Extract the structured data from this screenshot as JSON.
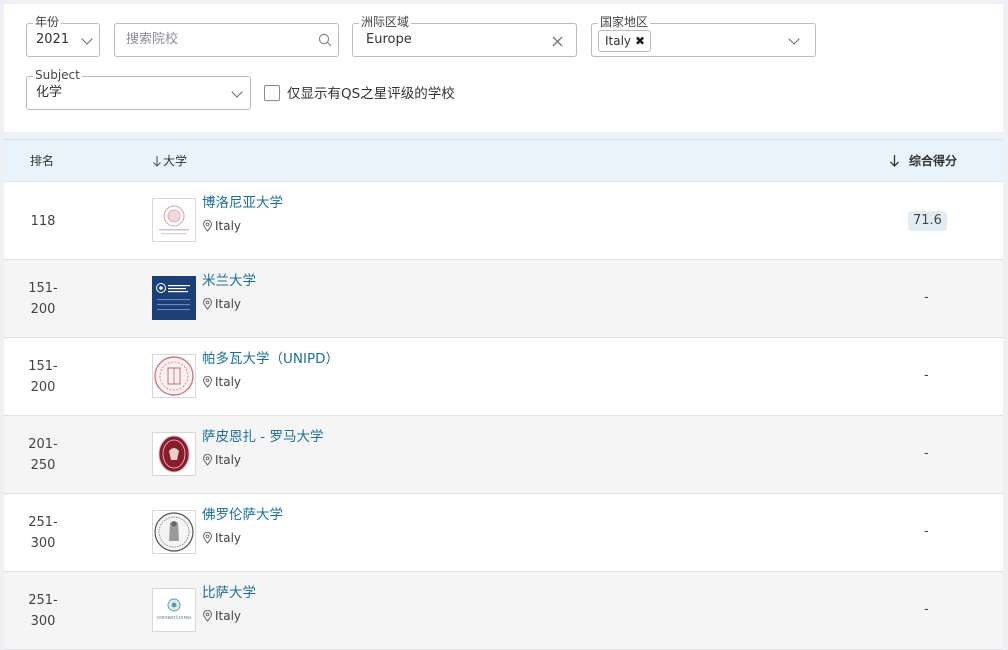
{
  "filters": {
    "year": {
      "legend": "年份",
      "value": "2021"
    },
    "search": {
      "placeholder": "搜索院校"
    },
    "region": {
      "legend": "洲际区域",
      "value": "Europe"
    },
    "country": {
      "legend": "国家地区",
      "tag": "Italy"
    },
    "subject": {
      "legend": "Subject",
      "value": "化学"
    },
    "qs_stars": {
      "label": "仅显示有QS之星评级的学校",
      "checked": false
    }
  },
  "table": {
    "headers": {
      "rank": "排名",
      "university": "大学",
      "score": "综合得分"
    },
    "rows": [
      {
        "rank_line1": "118",
        "rank_line2": "",
        "name": "博洛尼亚大学",
        "location": "Italy",
        "score": "71.6",
        "logo": "bologna-seal"
      },
      {
        "rank_line1": "151-",
        "rank_line2": "200",
        "name": "米兰大学",
        "location": "Italy",
        "score": "-",
        "logo": "milan-logo"
      },
      {
        "rank_line1": "151-",
        "rank_line2": "200",
        "name": "帕多瓦大学（UNIPD）",
        "location": "Italy",
        "score": "-",
        "logo": "padova-seal"
      },
      {
        "rank_line1": "201-",
        "rank_line2": "250",
        "name": "萨皮恩扎 - 罗马大学",
        "location": "Italy",
        "score": "-",
        "logo": "sapienza-seal"
      },
      {
        "rank_line1": "251-",
        "rank_line2": "300",
        "name": "佛罗伦萨大学",
        "location": "Italy",
        "score": "-",
        "logo": "florence-seal"
      },
      {
        "rank_line1": "251-",
        "rank_line2": "300",
        "name": "比萨大学",
        "location": "Italy",
        "score": "-",
        "logo": "pisa-logo"
      }
    ]
  },
  "logo_text": {
    "pisa": "UNIVERSITÀ DI PISA"
  },
  "colors": {
    "link": "#1a6f9a",
    "header_bg": "#e8f3fb",
    "alt_row": "#f5f5f5",
    "score_pill": "#e2ecf5"
  }
}
